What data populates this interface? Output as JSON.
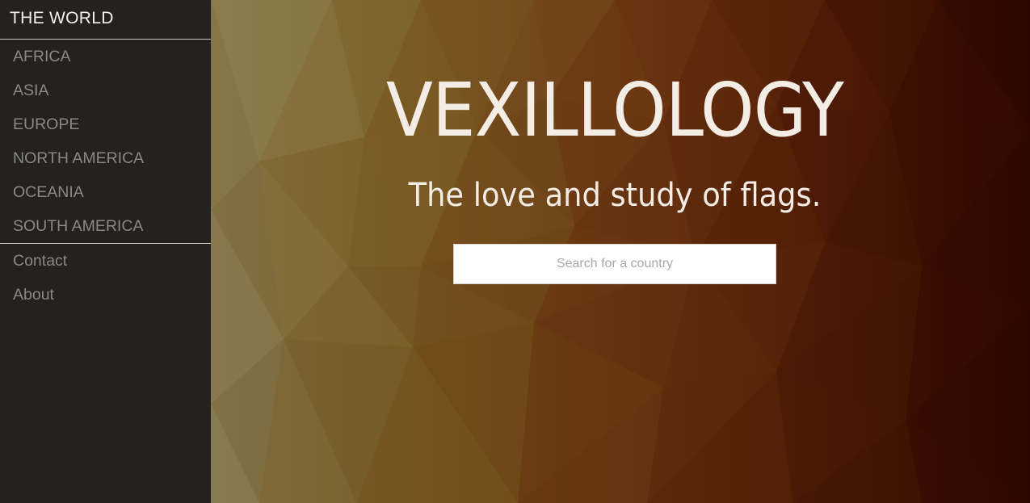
{
  "sidebar": {
    "title": "THE WORLD",
    "regions": [
      {
        "label": "AFRICA"
      },
      {
        "label": "ASIA"
      },
      {
        "label": "EUROPE"
      },
      {
        "label": "NORTH AMERICA"
      },
      {
        "label": "OCEANIA"
      },
      {
        "label": "SOUTH AMERICA"
      }
    ],
    "links": [
      {
        "label": "Contact"
      },
      {
        "label": "About"
      }
    ]
  },
  "hero": {
    "title": "VEXILLOLOGY",
    "subtitle": "The love and study of flags.",
    "search": {
      "placeholder": "Search for a country",
      "value": ""
    }
  },
  "colors": {
    "sidebar_bg": "#232220",
    "hero_left": "#8a7a4a",
    "hero_mid": "#7a4a1a",
    "hero_right": "#3a0c02",
    "hero_text": "#f3ede6"
  }
}
